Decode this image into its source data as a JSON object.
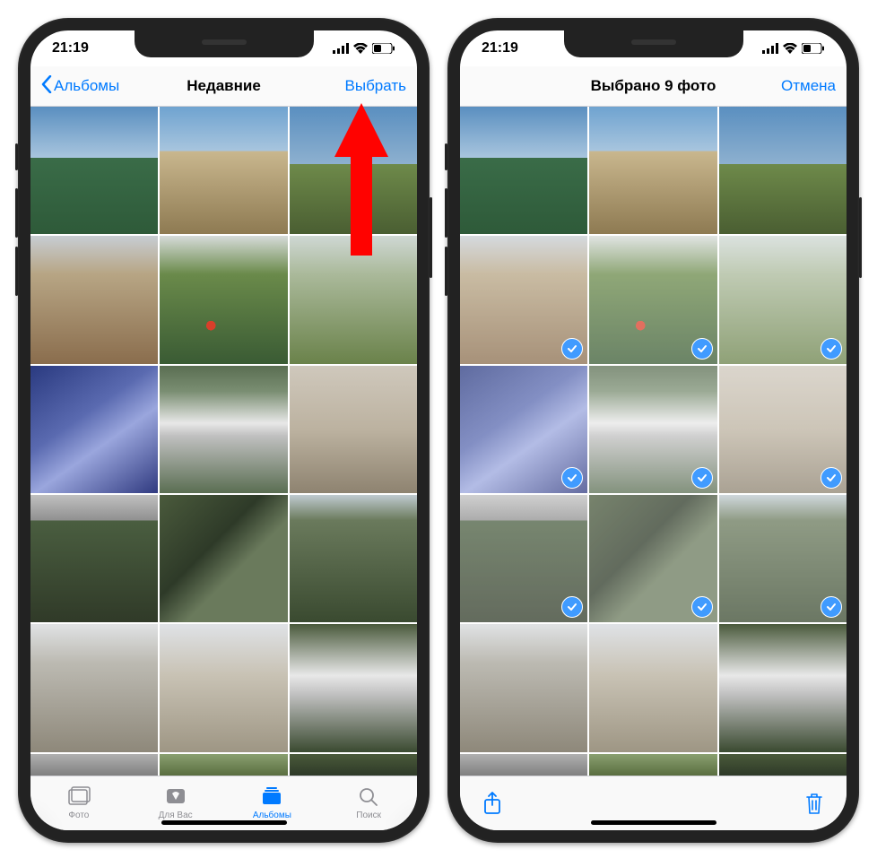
{
  "status": {
    "time": "21:19"
  },
  "phone_left": {
    "nav": {
      "back_label": "Альбомы",
      "title": "Недавние",
      "select_label": "Выбрать"
    },
    "tabs": {
      "photos": "Фото",
      "for_you": "Для Вас",
      "albums": "Альбомы",
      "search": "Поиск"
    },
    "annotation": {
      "type": "red-arrow-up",
      "points_to": "select-button"
    }
  },
  "phone_right": {
    "nav": {
      "title": "Выбрано 9 фото",
      "cancel_label": "Отмена"
    },
    "selected_indices": [
      3,
      4,
      5,
      6,
      7,
      8,
      9,
      10,
      11
    ],
    "actions": {
      "share": "share-icon",
      "delete": "trash-icon"
    }
  },
  "photos": [
    {
      "id": 0,
      "look": "sky"
    },
    {
      "id": 1,
      "look": "church"
    },
    {
      "id": 2,
      "look": "cliff"
    },
    {
      "id": 3,
      "look": "town"
    },
    {
      "id": 4,
      "look": "hill"
    },
    {
      "id": 5,
      "look": "meadow"
    },
    {
      "id": 6,
      "look": "bldg"
    },
    {
      "id": 7,
      "look": "falls"
    },
    {
      "id": 8,
      "look": "dry"
    },
    {
      "id": 9,
      "look": "road"
    },
    {
      "id": 10,
      "look": "gorge"
    },
    {
      "id": 11,
      "look": "canyon"
    },
    {
      "id": 12,
      "look": "tower"
    },
    {
      "id": 13,
      "look": "arch"
    },
    {
      "id": 14,
      "look": "falls2"
    },
    {
      "id": 15,
      "look": "sliver1"
    },
    {
      "id": 16,
      "look": "sliver2"
    },
    {
      "id": 17,
      "look": "sliver3"
    }
  ],
  "colors": {
    "accent": "#007aff",
    "annotation": "#ff0200"
  }
}
